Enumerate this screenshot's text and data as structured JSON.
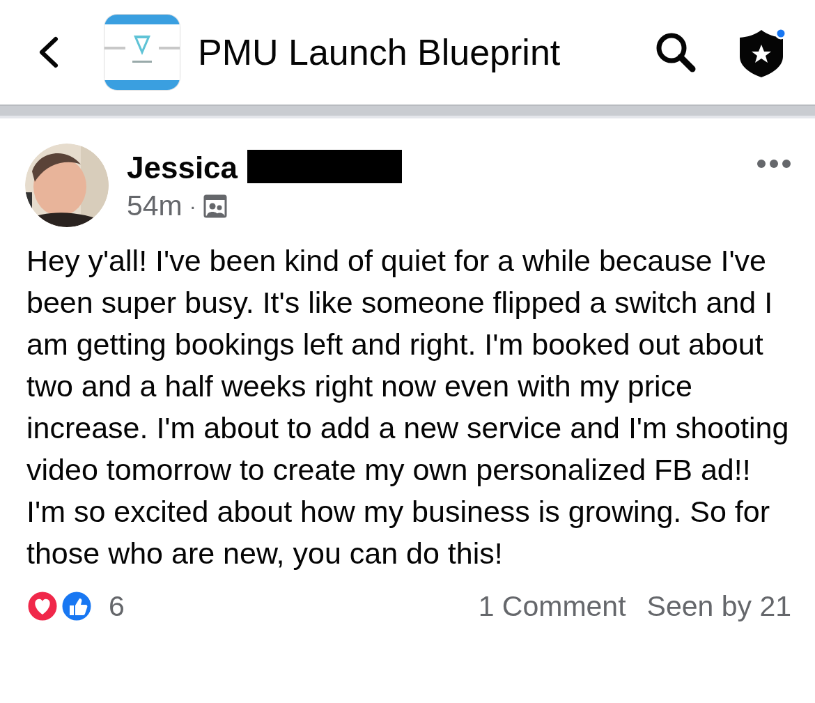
{
  "header": {
    "title": "PMU Launch Blueprint",
    "shield_notification": true
  },
  "post": {
    "author": "Jessica",
    "author_redacted": true,
    "time": "54m",
    "separator": "·",
    "text": "Hey y'all! I've been kind of quiet for a while because I've been super busy. It's like someone flipped a switch and I am getting bookings left and right. I'm booked out about two and a half weeks right now even with my price increase. I'm about to add a new service and I'm shooting video tomorrow to create my own personalized FB ad!!  I'm so excited about how my business is growing. So for those who are new, you can do this!",
    "reaction_count": "6",
    "comments": "1 Comment",
    "seen_by": "Seen by 21"
  }
}
